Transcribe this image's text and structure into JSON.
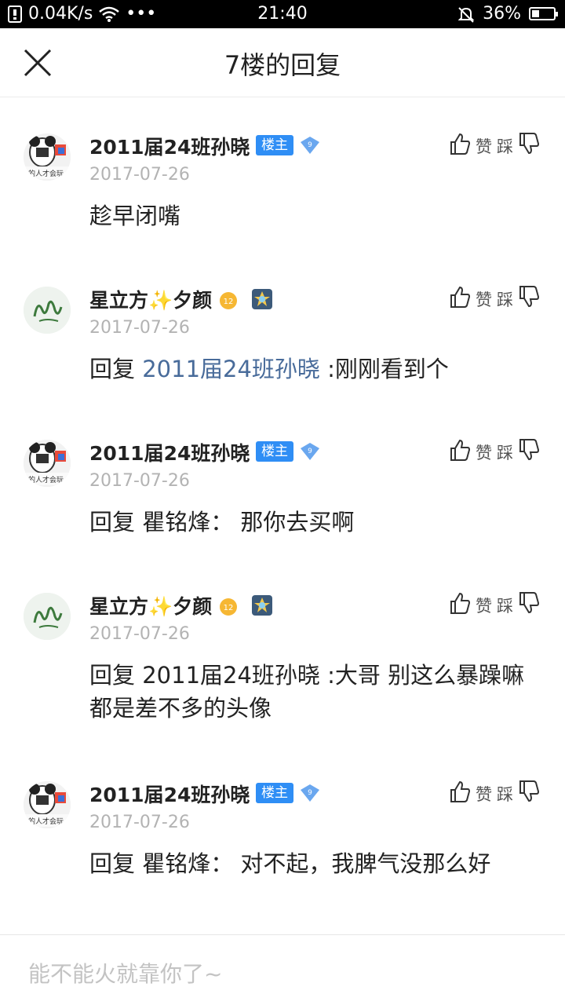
{
  "status_bar": {
    "speed": "0.04K/s",
    "dots": "•••",
    "time": "21:40",
    "battery": "36%",
    "battery_level": 0.36
  },
  "nav": {
    "title": "7楼的回复",
    "close_icon": "close-icon"
  },
  "replies": [
    {
      "user": "2011届24班孙晓",
      "owner_badge": "楼主",
      "level": "9",
      "date": "2017-07-26",
      "like_label": "赞",
      "dislike_label": "踩",
      "content": "趁早闭嘴"
    },
    {
      "user": "星立方✨夕颜",
      "level": "12",
      "date": "2017-07-26",
      "like_label": "赞",
      "dislike_label": "踩",
      "prefix": "回复 ",
      "mention": "2011届24班孙晓",
      "content": " :刚刚看到个"
    },
    {
      "user": "2011届24班孙晓",
      "owner_badge": "楼主",
      "level": "9",
      "date": "2017-07-26",
      "like_label": "赞",
      "dislike_label": "踩",
      "content": "回复 瞿铭烽： 那你去买啊"
    },
    {
      "user": "星立方✨夕颜",
      "level": "12",
      "date": "2017-07-26",
      "like_label": "赞",
      "dislike_label": "踩",
      "content": "回复 2011届24班孙晓 :大哥 别这么暴躁嘛 都是差不多的头像"
    },
    {
      "user": "2011届24班孙晓",
      "owner_badge": "楼主",
      "level": "9",
      "date": "2017-07-26",
      "like_label": "赞",
      "dislike_label": "踩",
      "content": "回复 瞿铭烽： 对不起，我脾气没那么好"
    }
  ],
  "footer": {
    "placeholder": "能不能火就靠你了~"
  },
  "colors": {
    "accent": "#2f8ef5",
    "mention": "#486b9a",
    "muted": "#b3b3b3"
  }
}
